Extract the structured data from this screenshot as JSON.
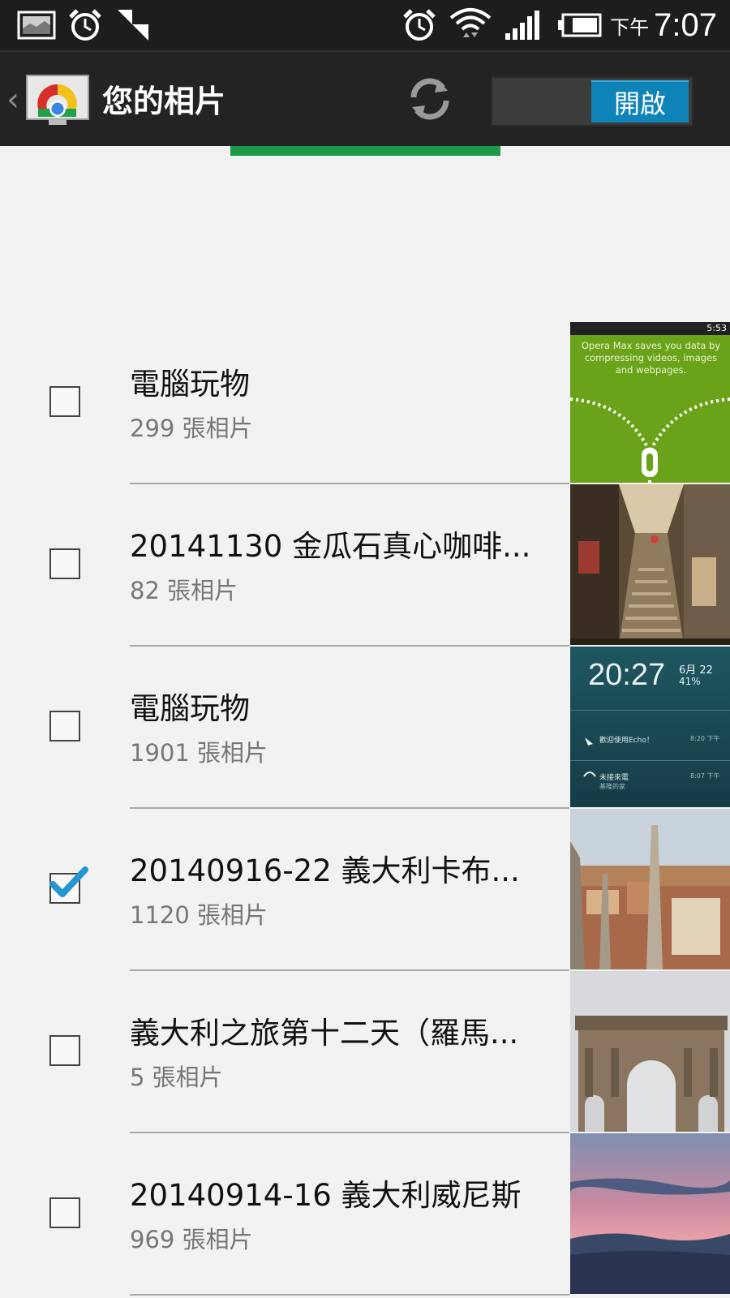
{
  "status_bar": {
    "ampm": "下午",
    "time": "7:07",
    "icons": [
      "gallery-notification-icon",
      "alarm-icon",
      "signal-partial-icon",
      "alarm-icon",
      "wifi-icon",
      "cell-signal-icon",
      "battery-icon"
    ]
  },
  "action_bar": {
    "title": "您的相片",
    "toggle_label": "開啟",
    "icons": [
      "back-chevron-icon",
      "chromecast-app-icon",
      "refresh-icon"
    ]
  },
  "albums": [
    {
      "title": "電腦玩物",
      "count": "299 張相片",
      "checked": false,
      "thumb": {
        "kind": "opera",
        "text": "Opera Max saves you data by compressing videos, images and webpages.",
        "status_time": "5:53"
      }
    },
    {
      "title": "20141130 金瓜石真心咖啡...",
      "count": "82 張相片",
      "checked": false,
      "thumb": {
        "kind": "street"
      }
    },
    {
      "title": "電腦玩物",
      "count": "1901 張相片",
      "checked": false,
      "thumb": {
        "kind": "lockscreen",
        "time": "20:27",
        "date": "6月 22",
        "battery": "41%",
        "line1": "歡迎使用Echo！",
        "line1_time": "8:20 下午",
        "line2": "未接來電",
        "line2_time": "8:07 下午",
        "line3": "基隆的家"
      }
    },
    {
      "title": "20140916-22 義大利卡布...",
      "count": "1120 張相片",
      "checked": true,
      "thumb": {
        "kind": "city"
      }
    },
    {
      "title": "義大利之旅第十二天（羅馬...",
      "count": "5 張相片",
      "checked": false,
      "thumb": {
        "kind": "arch"
      }
    },
    {
      "title": "20140914-16 義大利威尼斯",
      "count": "969 張相片",
      "checked": false,
      "thumb": {
        "kind": "sunset"
      }
    }
  ],
  "colors": {
    "accent_green": "#1c9a4a",
    "toggle_blue": "#0f84b9",
    "check_blue": "#2596d0"
  }
}
